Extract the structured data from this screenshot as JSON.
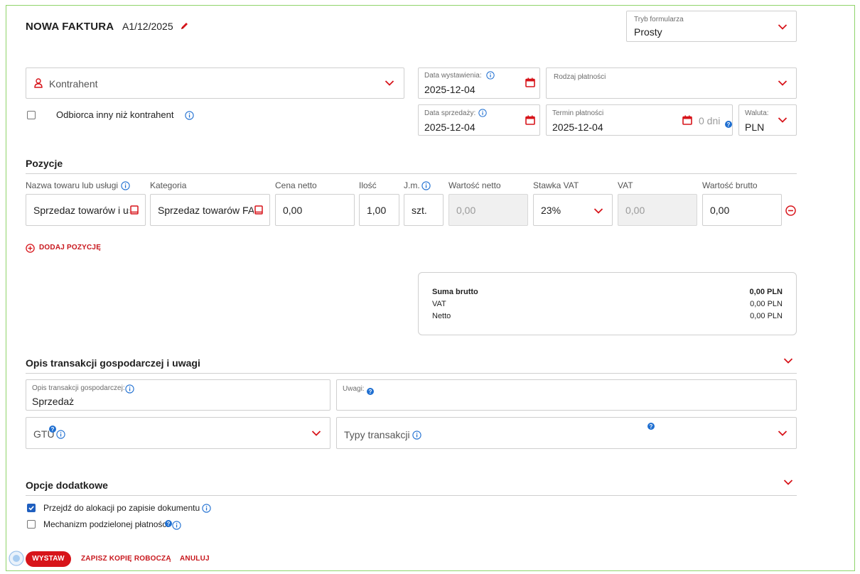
{
  "header": {
    "title": "NOWA FAKTURA",
    "doc_number": "A1/12/2025",
    "form_mode_label": "Tryb formularza",
    "form_mode_value": "Prosty"
  },
  "contractor": {
    "placeholder": "Kontrahent",
    "recipient_other_label": "Odbiorca inny niż kontrahent"
  },
  "dates": {
    "issue_label": "Data wystawienia:",
    "issue_value": "2025-12-04",
    "sale_label": "Data sprzedaży:",
    "sale_value": "2025-12-04",
    "payment_type_label": "Rodzaj płatności",
    "due_label": "Termin płatności",
    "due_value": "2025-12-04",
    "due_days": "0 dni",
    "currency_label": "Waluta:",
    "currency_value": "PLN"
  },
  "positions": {
    "section_title": "Pozycje",
    "columns": [
      "Nazwa towaru lub usługi",
      "Kategoria",
      "Cena netto",
      "Ilość",
      "J.m.",
      "Wartość netto",
      "Stawka VAT",
      "VAT",
      "Wartość brutto"
    ],
    "row": {
      "name": "Sprzedaz towarów i us",
      "category": "Sprzedaz towarów FAK",
      "net_price": "0,00",
      "quantity": "1,00",
      "unit": "szt.",
      "net_value": "0,00",
      "vat_rate": "23%",
      "vat": "0,00",
      "gross_value": "0,00"
    },
    "add_label": "DODAJ POZYCJĘ"
  },
  "summary": {
    "gross_label": "Suma brutto",
    "gross_value": "0,00 PLN",
    "vat_label": "VAT",
    "vat_value": "0,00 PLN",
    "net_label": "Netto",
    "net_value": "0,00 PLN"
  },
  "description": {
    "section_title": "Opis transakcji gospodarczej i uwagi",
    "desc_label": "Opis transakcji gospodarczej:",
    "desc_value": "Sprzedaż",
    "notes_label": "Uwagi:",
    "gtu_placeholder": "GTU",
    "tx_types_placeholder": "Typy transakcji"
  },
  "options": {
    "section_title": "Opcje dodatkowe",
    "alloc_label": "Przejdź do alokacji po zapisie dokumentu",
    "alloc_checked": true,
    "split_label": "Mechanizm podzielonej płatności",
    "split_checked": false
  },
  "actions": {
    "issue": "WYSTAW",
    "save_draft": "ZAPISZ KOPIĘ ROBOCZĄ",
    "cancel": "ANULUJ"
  },
  "colors": {
    "accent_red": "#d7141a",
    "info_blue": "#1f6fd1",
    "frame_green": "#8fd36a"
  }
}
